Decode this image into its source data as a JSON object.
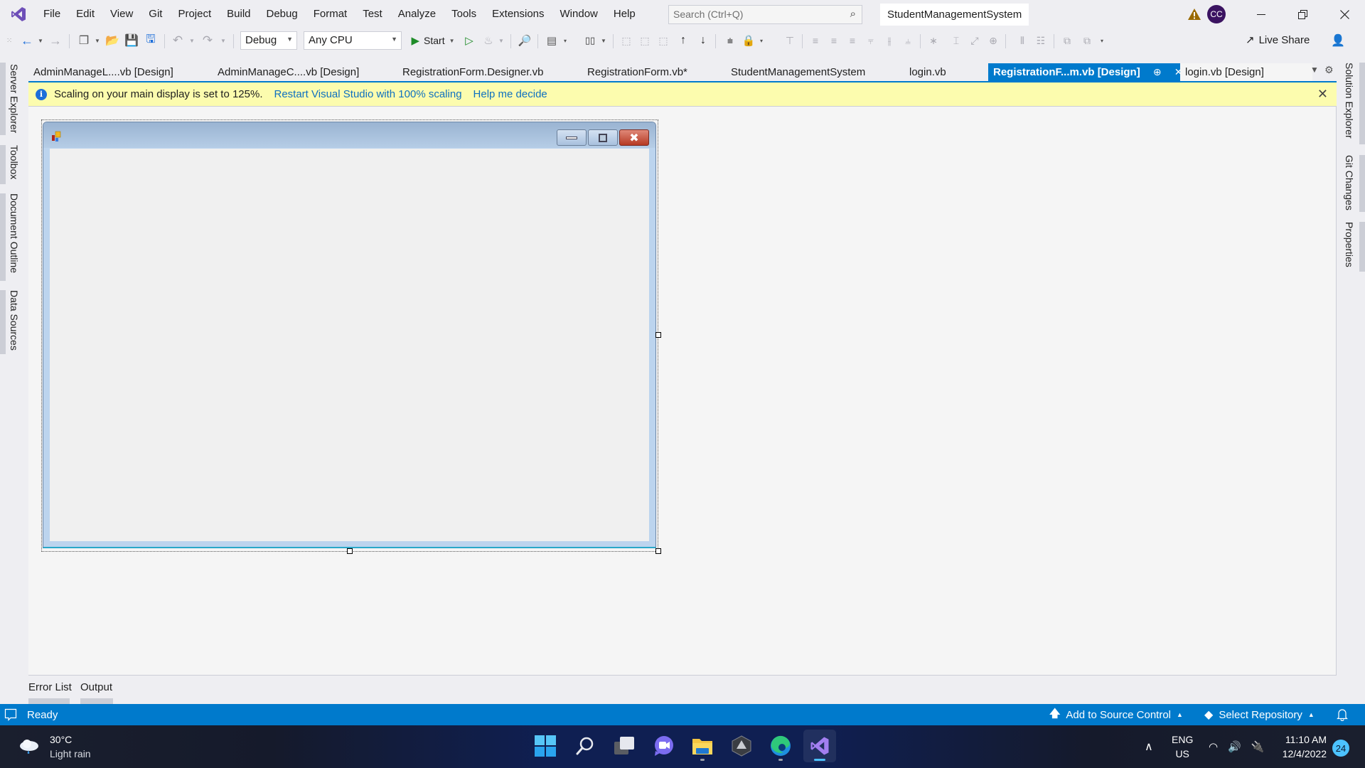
{
  "app": {
    "solution_name": "StudentManagementSystem",
    "account_initials": "CC",
    "search_placeholder": "Search (Ctrl+Q)"
  },
  "menu": [
    "File",
    "Edit",
    "View",
    "Git",
    "Project",
    "Build",
    "Debug",
    "Format",
    "Test",
    "Analyze",
    "Tools",
    "Extensions",
    "Window",
    "Help"
  ],
  "toolbar": {
    "configuration": "Debug",
    "platform": "Any CPU",
    "start_label": "Start",
    "live_share_label": "Live Share"
  },
  "left_rail": [
    "Server Explorer",
    "Toolbox",
    "Document Outline",
    "Data Sources"
  ],
  "right_rail": [
    "Solution Explorer",
    "Git Changes",
    "Properties"
  ],
  "doc_tabs": [
    {
      "label": "AdminManageL....vb [Design]",
      "active": false
    },
    {
      "label": "AdminManageC....vb [Design]",
      "active": false
    },
    {
      "label": "RegistrationForm.Designer.vb",
      "active": false
    },
    {
      "label": "RegistrationForm.vb*",
      "active": false
    },
    {
      "label": "StudentManagementSystem",
      "active": false
    },
    {
      "label": "login.vb",
      "active": false
    },
    {
      "label": "RegistrationF...m.vb [Design]",
      "active": true
    },
    {
      "label": "login.vb [Design]",
      "active": false
    }
  ],
  "infobar": {
    "message": "Scaling on your main display is set to 125%.",
    "link_restart": "Restart Visual Studio with 100% scaling",
    "link_help": "Help me decide"
  },
  "tool_tabs": [
    "Error List",
    "Output"
  ],
  "statusbar": {
    "status": "Ready",
    "add_source_control": "Add to Source Control",
    "select_repository": "Select Repository"
  },
  "taskbar": {
    "weather_temp": "30°C",
    "weather_desc": "Light rain",
    "lang_1": "ENG",
    "lang_2": "US",
    "time": "11:10 AM",
    "date": "12/4/2022",
    "notification_count": "24"
  },
  "colors": {
    "accent": "#007acc",
    "infobar_bg": "#fcfcae",
    "link": "#0e70c0"
  }
}
